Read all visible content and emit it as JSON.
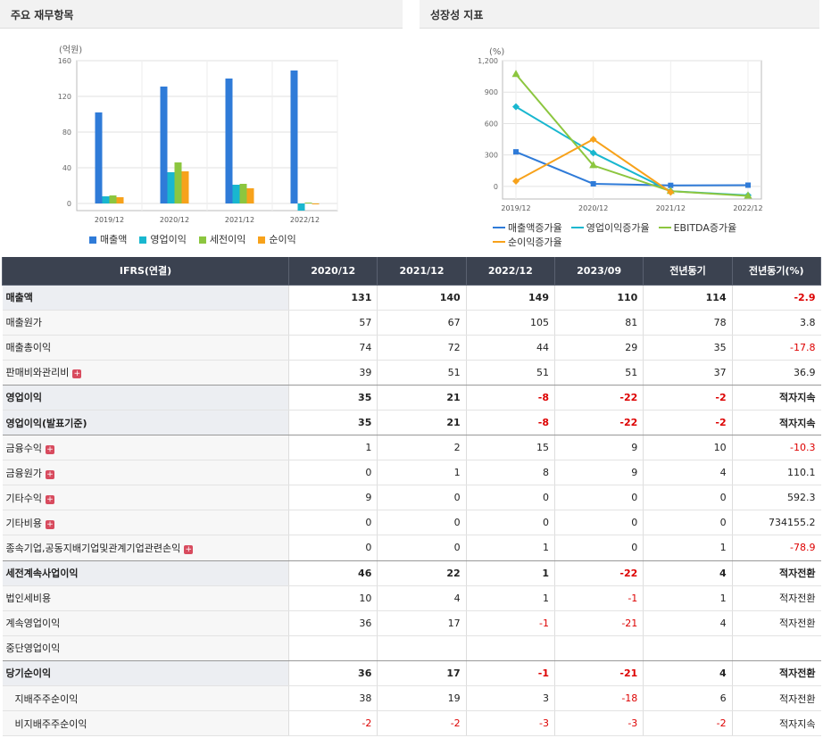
{
  "panels": {
    "left_title": "주요 재무항목",
    "right_title": "성장성 지표"
  },
  "chart_data": [
    {
      "type": "bar",
      "ylabel_unit": "(억원)",
      "categories": [
        "2019/12",
        "2020/12",
        "2021/12",
        "2022/12"
      ],
      "ylim": [
        -8,
        160
      ],
      "yticks": [
        0,
        40,
        80,
        120,
        160
      ],
      "series": [
        {
          "name": "매출액",
          "color": "#2f7bd8",
          "values": [
            102,
            131,
            140,
            149
          ]
        },
        {
          "name": "영업이익",
          "color": "#19b7cf",
          "values": [
            8,
            35,
            21,
            -8
          ]
        },
        {
          "name": "세전이익",
          "color": "#8cc63f",
          "values": [
            9,
            46,
            22,
            1
          ]
        },
        {
          "name": "순이익",
          "color": "#f7a21b",
          "values": [
            7,
            36,
            17,
            -1
          ]
        }
      ]
    },
    {
      "type": "line",
      "ylabel_unit": "(%)",
      "categories": [
        "2019/12",
        "2020/12",
        "2021/12",
        "2022/12"
      ],
      "ylim": [
        -120,
        1200
      ],
      "yticks": [
        0,
        300,
        600,
        900,
        1200
      ],
      "ytick_labels": [
        "0",
        "300",
        "600",
        "900",
        "1,200"
      ],
      "series": [
        {
          "name": "매출액증가율",
          "color": "#2f7bd8",
          "marker": "square",
          "values": [
            330,
            25,
            10,
            12
          ]
        },
        {
          "name": "영업이익증가율",
          "color": "#19b7cf",
          "marker": "diamond",
          "values": [
            760,
            320,
            -45,
            -85
          ]
        },
        {
          "name": "EBITDA증가율",
          "color": "#8cc63f",
          "marker": "triangle",
          "values": [
            1070,
            200,
            -45,
            -90
          ]
        },
        {
          "name": "순이익증가율",
          "color": "#f7a21b",
          "marker": "diamond",
          "values": [
            50,
            450,
            -55,
            null
          ]
        }
      ]
    }
  ],
  "table": {
    "headers": [
      "IFRS(연결)",
      "2020/12",
      "2021/12",
      "2022/12",
      "2023/09",
      "전년동기",
      "전년동기(%)"
    ],
    "rows": [
      {
        "label": "매출액",
        "bold": true,
        "plus": false,
        "indent": false,
        "values": [
          "131",
          "140",
          "149",
          "110",
          "114",
          "-2.9"
        ]
      },
      {
        "label": "매출원가",
        "bold": false,
        "plus": false,
        "indent": false,
        "values": [
          "57",
          "67",
          "105",
          "81",
          "78",
          "3.8"
        ]
      },
      {
        "label": "매출총이익",
        "bold": false,
        "plus": false,
        "indent": false,
        "values": [
          "74",
          "72",
          "44",
          "29",
          "35",
          "-17.8"
        ]
      },
      {
        "label": "판매비와관리비",
        "bold": false,
        "plus": true,
        "indent": false,
        "values": [
          "39",
          "51",
          "51",
          "51",
          "37",
          "36.9"
        ]
      },
      {
        "label": "영업이익",
        "bold": true,
        "plus": false,
        "indent": false,
        "values": [
          "35",
          "21",
          "-8",
          "-22",
          "-2",
          "적자지속"
        ]
      },
      {
        "label": "영업이익(발표기준)",
        "bold": true,
        "plus": false,
        "indent": false,
        "values": [
          "35",
          "21",
          "-8",
          "-22",
          "-2",
          "적자지속"
        ]
      },
      {
        "label": "금융수익",
        "bold": false,
        "plus": true,
        "indent": false,
        "values": [
          "1",
          "2",
          "15",
          "9",
          "10",
          "-10.3"
        ]
      },
      {
        "label": "금융원가",
        "bold": false,
        "plus": true,
        "indent": false,
        "values": [
          "0",
          "1",
          "8",
          "9",
          "4",
          "110.1"
        ]
      },
      {
        "label": "기타수익",
        "bold": false,
        "plus": true,
        "indent": false,
        "values": [
          "9",
          "0",
          "0",
          "0",
          "0",
          "592.3"
        ]
      },
      {
        "label": "기타비용",
        "bold": false,
        "plus": true,
        "indent": false,
        "values": [
          "0",
          "0",
          "0",
          "0",
          "0",
          "734155.2"
        ]
      },
      {
        "label": "종속기업,공동지배기업및관계기업관련손익",
        "bold": false,
        "plus": true,
        "indent": false,
        "values": [
          "0",
          "0",
          "1",
          "0",
          "1",
          "-78.9"
        ]
      },
      {
        "label": "세전계속사업이익",
        "bold": true,
        "plus": false,
        "indent": false,
        "values": [
          "46",
          "22",
          "1",
          "-22",
          "4",
          "적자전환"
        ]
      },
      {
        "label": "법인세비용",
        "bold": false,
        "plus": false,
        "indent": false,
        "values": [
          "10",
          "4",
          "1",
          "-1",
          "1",
          "적자전환"
        ]
      },
      {
        "label": "계속영업이익",
        "bold": false,
        "plus": false,
        "indent": false,
        "values": [
          "36",
          "17",
          "-1",
          "-21",
          "4",
          "적자전환"
        ]
      },
      {
        "label": "중단영업이익",
        "bold": false,
        "plus": false,
        "indent": false,
        "values": [
          "",
          "",
          "",
          "",
          "",
          ""
        ]
      },
      {
        "label": "당기순이익",
        "bold": true,
        "plus": false,
        "indent": false,
        "values": [
          "36",
          "17",
          "-1",
          "-21",
          "4",
          "적자전환"
        ]
      },
      {
        "label": "지배주주순이익",
        "bold": false,
        "plus": false,
        "indent": true,
        "values": [
          "38",
          "19",
          "3",
          "-18",
          "6",
          "적자전환"
        ]
      },
      {
        "label": "비지배주주순이익",
        "bold": false,
        "plus": false,
        "indent": true,
        "values": [
          "-2",
          "-2",
          "-3",
          "-3",
          "-2",
          "적자지속"
        ]
      }
    ]
  }
}
